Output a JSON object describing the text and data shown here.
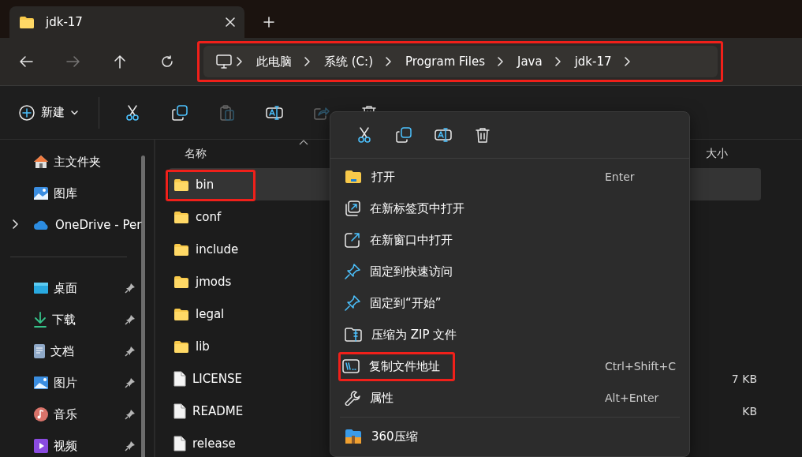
{
  "tabs": [
    {
      "title": "jdk-17",
      "selected": true
    }
  ],
  "nav_buttons": [
    {
      "kind": "back",
      "disabled": false
    },
    {
      "kind": "forward",
      "disabled": true
    },
    {
      "kind": "up",
      "disabled": false
    },
    {
      "kind": "refresh",
      "disabled": false
    }
  ],
  "address_bar": {
    "highlighted": true,
    "segments": [
      "此电脑",
      "系统 (C:)",
      "Program Files",
      "Java",
      "jdk-17"
    ]
  },
  "toolbar": {
    "new_label": "新建",
    "actions": [
      {
        "kind": "cut",
        "disabled": false
      },
      {
        "kind": "copy",
        "disabled": false
      },
      {
        "kind": "paste",
        "disabled": true
      },
      {
        "kind": "rename",
        "disabled": false
      },
      {
        "kind": "share",
        "disabled": true
      },
      {
        "kind": "delete",
        "disabled": false
      }
    ]
  },
  "sidebar": {
    "items": [
      {
        "label": "主文件夹",
        "kind": "home",
        "pinned": false
      },
      {
        "label": "图库",
        "kind": "gallery",
        "pinned": false
      },
      {
        "label": "OneDrive - Per",
        "kind": "cloud",
        "pinned": false
      },
      {
        "kind": "divider"
      },
      {
        "label": "桌面",
        "kind": "desktop",
        "pinned": true
      },
      {
        "label": "下载",
        "kind": "download",
        "pinned": true
      },
      {
        "label": "文档",
        "kind": "document",
        "pinned": true
      },
      {
        "label": "图片",
        "kind": "pictures",
        "pinned": true
      },
      {
        "label": "音乐",
        "kind": "music",
        "pinned": true
      },
      {
        "label": "视频",
        "kind": "video",
        "pinned": true
      }
    ]
  },
  "file_list": {
    "columns": [
      "名称",
      "大小"
    ],
    "rows": [
      {
        "name": "bin",
        "kind": "folder",
        "selected": true,
        "highlighted": true
      },
      {
        "name": "conf",
        "kind": "folder",
        "selected": false,
        "highlighted": false
      },
      {
        "name": "include",
        "kind": "folder",
        "selected": false,
        "highlighted": false
      },
      {
        "name": "jmods",
        "kind": "folder",
        "selected": false,
        "highlighted": false
      },
      {
        "name": "legal",
        "kind": "folder",
        "selected": false,
        "highlighted": false
      },
      {
        "name": "lib",
        "kind": "folder",
        "selected": false,
        "highlighted": false
      },
      {
        "name": "LICENSE",
        "kind": "file",
        "size": "7 KB",
        "selected": false,
        "highlighted": false
      },
      {
        "name": "README",
        "kind": "file",
        "size": "KB",
        "selected": false,
        "highlighted": false
      },
      {
        "name": "release",
        "kind": "file",
        "selected": false,
        "highlighted": false
      }
    ]
  },
  "context_menu": {
    "quick_actions": [
      {
        "kind": "cut"
      },
      {
        "kind": "copy"
      },
      {
        "kind": "rename"
      },
      {
        "kind": "delete"
      }
    ],
    "items": [
      {
        "label": "打开",
        "kind": "open",
        "shortcut": "Enter",
        "highlighted": false
      },
      {
        "label": "在新标签页中打开",
        "kind": "newtab",
        "highlighted": false
      },
      {
        "label": "在新窗口中打开",
        "kind": "newwindow",
        "highlighted": false
      },
      {
        "label": "固定到快速访问",
        "kind": "pin",
        "highlighted": false
      },
      {
        "label": "固定到“开始”",
        "kind": "pin",
        "highlighted": false
      },
      {
        "label": "压缩为 ZIP 文件",
        "kind": "zip",
        "highlighted": false
      },
      {
        "label": "复制文件地址",
        "kind": "copypath",
        "shortcut": "Ctrl+Shift+C",
        "highlighted": true
      },
      {
        "label": "属性",
        "kind": "properties",
        "shortcut": "Alt+Enter",
        "highlighted": false
      }
    ],
    "extra_items": [
      {
        "label": "360压缩",
        "kind": "archive"
      }
    ]
  }
}
